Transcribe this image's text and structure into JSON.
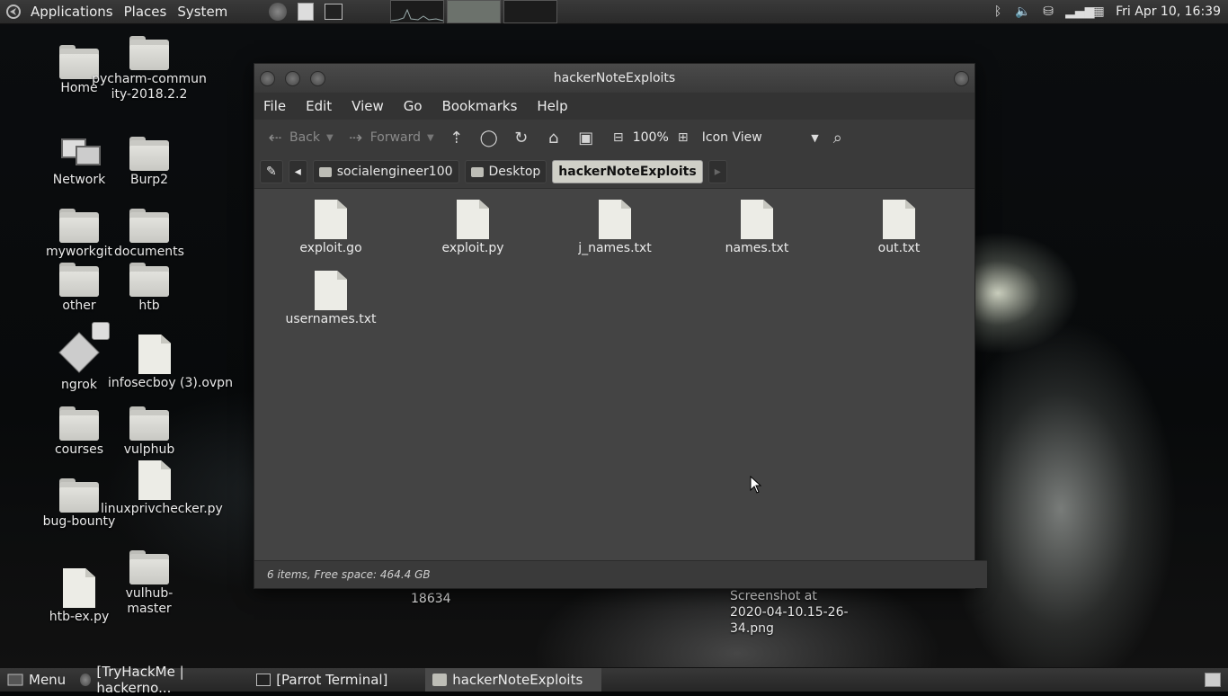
{
  "top_panel": {
    "menus": [
      "Applications",
      "Places",
      "System"
    ],
    "clock": "Fri Apr 10, 16:39"
  },
  "desktop": {
    "icons": [
      {
        "label": "Home",
        "kind": "folder"
      },
      {
        "label": "pycharm-community-2018.2.2",
        "kind": "folder"
      },
      {
        "label": "Network",
        "kind": "network"
      },
      {
        "label": "Burp2",
        "kind": "folder"
      },
      {
        "label": "myworkgit",
        "kind": "folder"
      },
      {
        "label": "documents",
        "kind": "folder"
      },
      {
        "label": "other",
        "kind": "folder"
      },
      {
        "label": "htb",
        "kind": "folder"
      },
      {
        "label": "ngrok",
        "kind": "app"
      },
      {
        "label": "infosecboy (3).ovpn",
        "kind": "file"
      },
      {
        "label": "courses",
        "kind": "folder"
      },
      {
        "label": "vulphub",
        "kind": "folder"
      },
      {
        "label": "bug-bounty",
        "kind": "folder"
      },
      {
        "label": "linuxprivchecker.py",
        "kind": "file"
      },
      {
        "label": "htb-ex.py",
        "kind": "file"
      },
      {
        "label": "vulhub-master",
        "kind": "folder"
      }
    ],
    "loose_labels": [
      "18634",
      "Screenshot at 2020-04-10.15-26-34.png"
    ]
  },
  "window": {
    "title": "hackerNoteExploits",
    "menu": [
      "File",
      "Edit",
      "View",
      "Go",
      "Bookmarks",
      "Help"
    ],
    "toolbar": {
      "back": "Back",
      "forward": "Forward",
      "zoom": "100%",
      "view": "Icon View"
    },
    "path": [
      "socialengineer100",
      "Desktop",
      "hackerNoteExploits"
    ],
    "files": [
      "exploit.go",
      "exploit.py",
      "j_names.txt",
      "names.txt",
      "out.txt",
      "usernames.txt"
    ],
    "status": "6 items, Free space: 464.4 GB"
  },
  "bottom_panel": {
    "menu": "Menu",
    "tasks": [
      "[TryHackMe | hackerno...",
      "[Parrot Terminal]",
      "hackerNoteExploits"
    ]
  }
}
